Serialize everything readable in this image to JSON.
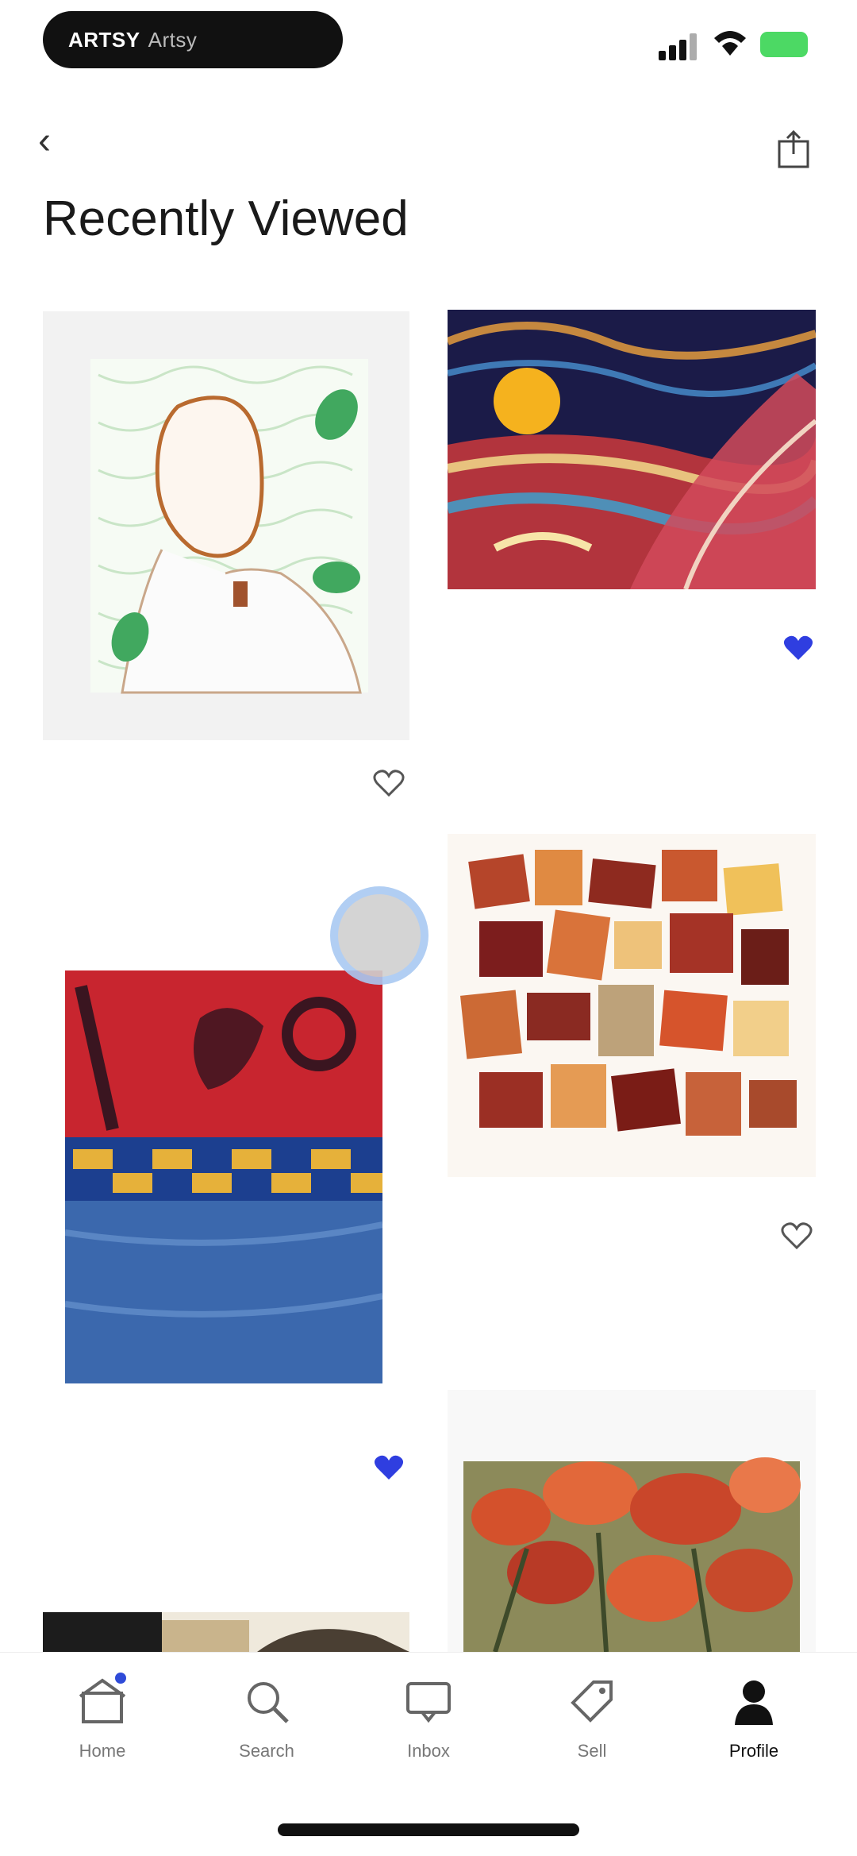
{
  "status_bar": {
    "pill_label": "ARTSY",
    "pill_sub": "Artsy",
    "battery_color": "#4cd964"
  },
  "header": {
    "back_icon": "chevron-left-icon",
    "share_icon": "share-icon",
    "title": "Recently Viewed"
  },
  "artworks": [
    {
      "artist": "",
      "title": "",
      "year": "",
      "partner": "",
      "price": "",
      "note": "",
      "saved": false,
      "save_count": ""
    },
    {
      "artist": "",
      "title": "",
      "year": "",
      "partner": "",
      "price": "",
      "note": "",
      "saved": true,
      "save_count": ""
    },
    {
      "artist": "",
      "title": "",
      "year": "",
      "partner": "",
      "price": "",
      "saved": false
    },
    {
      "artist": "",
      "title": "",
      "year": "",
      "partner": "",
      "price": "",
      "saved": true
    }
  ],
  "tabbar": {
    "tabs": [
      {
        "label": "Home",
        "icon": "home-icon"
      },
      {
        "label": "Search",
        "icon": "search-icon"
      },
      {
        "label": "Inbox",
        "icon": "inbox-icon"
      },
      {
        "label": "Sell",
        "icon": "tag-icon"
      },
      {
        "label": "Profile",
        "icon": "profile-icon"
      }
    ],
    "accent": "#2f4bd8"
  }
}
